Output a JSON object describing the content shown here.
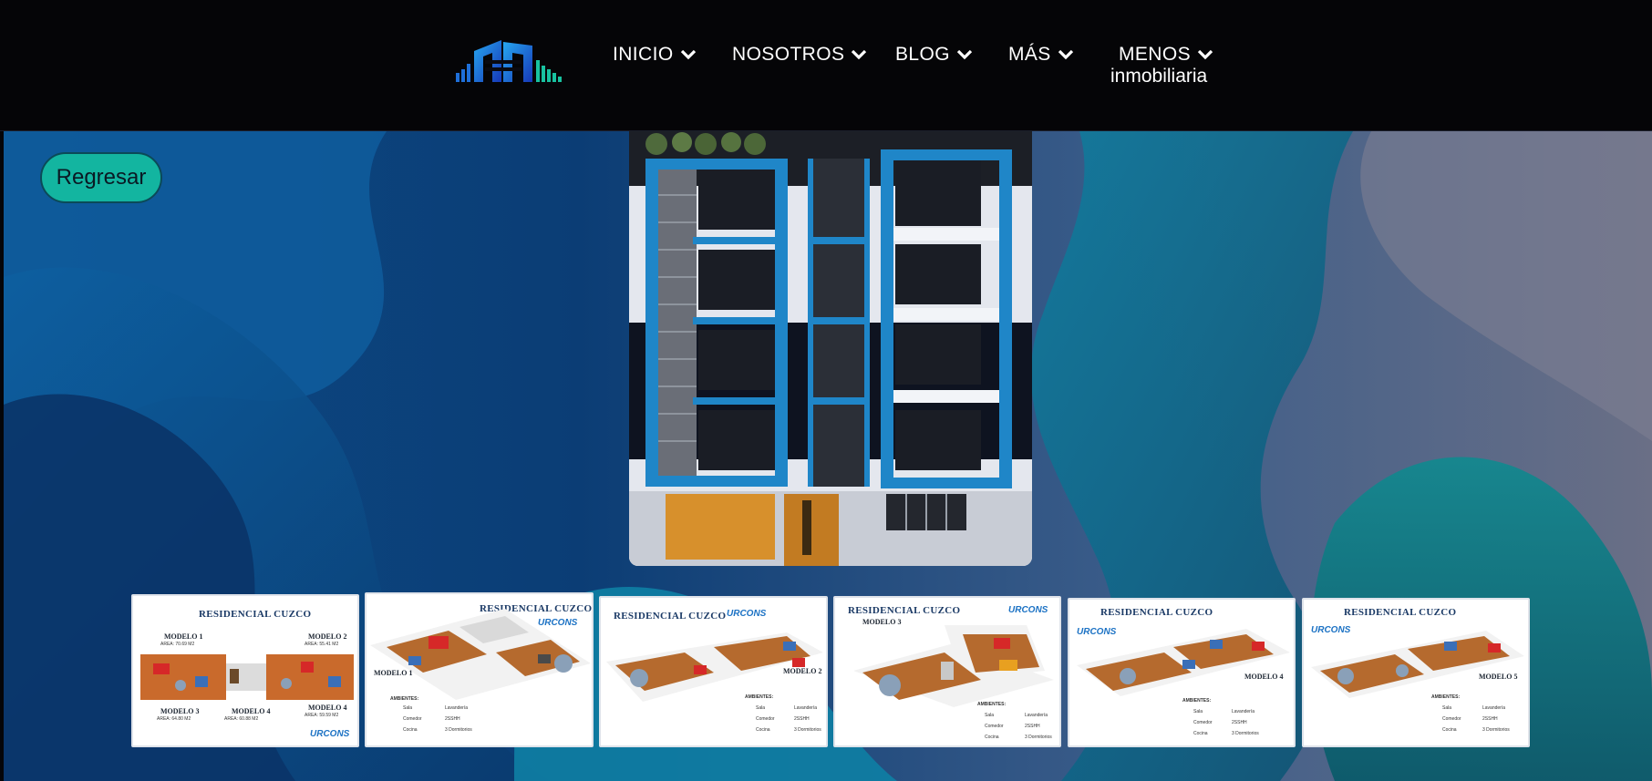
{
  "nav": {
    "items": [
      {
        "label": "INICIO"
      },
      {
        "label": "NOSOTROS"
      },
      {
        "label": "BLOG"
      },
      {
        "label": "MÁS"
      },
      {
        "label": "MENOS",
        "sub": "inmobiliaria"
      }
    ]
  },
  "back_button": {
    "label": "Regresar"
  },
  "thumbnails": [
    {
      "title": "RESIDENCIAL CUZCO",
      "models": [
        "MODELO 1",
        "MODELO 2",
        "MODELO 3",
        "MODELO 4",
        "MODELO 4"
      ],
      "areas": [
        "AREA: 70.69 M2",
        "AREA: 55.41 M2",
        "AREA: 64.80 M2",
        "AREA: 60.88 M2",
        "AREA: 59.59 M2"
      ],
      "brand": "URCONS"
    },
    {
      "title": "RESIDENCIAL CUZCO",
      "model": "MODELO 1",
      "section": "AMBIENTES:",
      "items": [
        "Sala",
        "Comedor",
        "Cocina",
        "Lavandería",
        "2SSHH",
        "3 Dormitorios"
      ],
      "brand": "URCONS"
    },
    {
      "title": "RESIDENCIAL CUZCO",
      "model": "MODELO 2",
      "section": "AMBIENTES:",
      "items": [
        "Sala",
        "Comedor",
        "Cocina",
        "Lavandería",
        "2SSHH",
        "3 Dormitorios"
      ],
      "brand": "URCONS"
    },
    {
      "title": "RESIDENCIAL CUZCO",
      "model": "MODELO 3",
      "section": "AMBIENTES:",
      "items": [
        "Sala",
        "Comedor",
        "Cocina",
        "Lavandería",
        "2SSHH",
        "3 Dormitorios"
      ],
      "brand": "URCONS"
    },
    {
      "title": "RESIDENCIAL CUZCO",
      "model": "MODELO 4",
      "section": "AMBIENTES:",
      "items": [
        "Sala",
        "Comedor",
        "Cocina",
        "Lavandería",
        "2SSHH",
        "3 Dormitorios"
      ],
      "brand": "URCONS"
    },
    {
      "title": "RESIDENCIAL CUZCO",
      "model": "MODELO 5",
      "section": "AMBIENTES:",
      "items": [
        "Sala",
        "Comedor",
        "Cocina",
        "Lavandería",
        "2SSHH",
        "3 Dormitorios"
      ],
      "brand": "URCONS"
    }
  ],
  "colors": {
    "header_bg": "#050507",
    "accent": "#13b5a0",
    "logo_blue": "#1e6fd9",
    "logo_teal": "#18c2a0"
  }
}
